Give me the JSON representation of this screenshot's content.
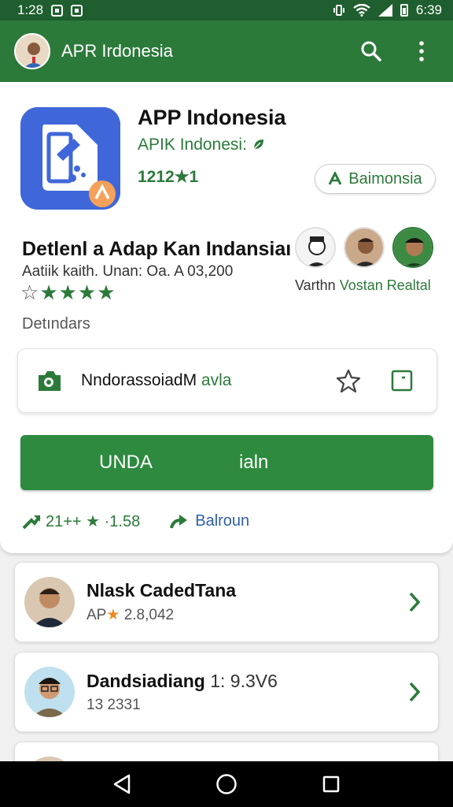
{
  "status_bar": {
    "time": "1:28",
    "clock": "6:39"
  },
  "app_bar": {
    "title": "APR Irdonesia"
  },
  "app": {
    "name": "APP Indonesia",
    "developer": "APIK Indonesi:",
    "rating_count": "1212",
    "rating_suffix": "1",
    "chip_label": "Baimonsia"
  },
  "details": {
    "headline": "Detlenl a Adap Kan Indansiaı",
    "subline": "Aatiik kaith. Unan: Oa. A 03,200",
    "people_name_1": "Varthn",
    "people_name_2": "Vostan Realtal",
    "section_label": "Detındars"
  },
  "info_card": {
    "text": "NndorassoiadM",
    "accent": "avla"
  },
  "install": {
    "label": "UNDA",
    "extra": "ialn"
  },
  "stats": {
    "left": "21++ ★ ·1.58",
    "right": "Balroun"
  },
  "list": [
    {
      "title": "Nlask CadedTana",
      "sub_prefix": "AP",
      "sub_value": "2.8,042"
    },
    {
      "title": "Dandsiadiang",
      "title_suffix": "1: 9.3V6",
      "sub": "13 2331"
    }
  ],
  "colors": {
    "primary": "#2b7a3a",
    "status_bar": "#1f5e2e",
    "app_icon": "#3f67d9",
    "accent_orange": "#e98a1e"
  }
}
